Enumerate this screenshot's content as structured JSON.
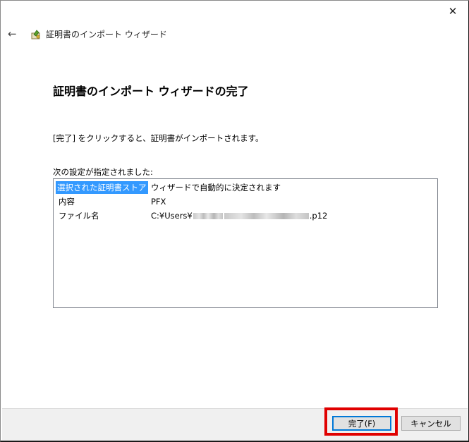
{
  "window": {
    "close_glyph": "✕"
  },
  "header": {
    "back_glyph": "←",
    "wizard_title": "証明書のインポート ウィザード",
    "icon": "certificate-icon"
  },
  "main": {
    "heading": "証明書のインポート ウィザードの完了",
    "description": "[完了] をクリックすると、証明書がインポートされます。",
    "list_label": "次の設定が指定されました:",
    "settings": [
      {
        "key": "選択された証明書ストア",
        "value": "ウィザードで自動的に決定されます"
      },
      {
        "key": "内容",
        "value": "PFX"
      },
      {
        "key": "ファイル名",
        "value_prefix": "C:¥Users¥",
        "value_suffix": ".p12"
      }
    ]
  },
  "footer": {
    "finish_label": "完了(F)",
    "cancel_label": "キャンセル"
  },
  "colors": {
    "selection": "#3399ff",
    "highlight_box": "#e00000",
    "default_button_border": "#0078d7"
  }
}
